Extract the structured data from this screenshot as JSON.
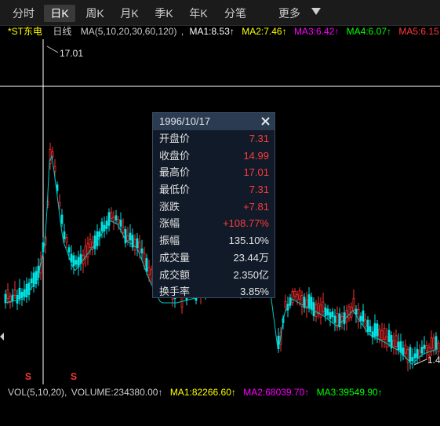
{
  "tabs": [
    {
      "label": "分时",
      "active": false
    },
    {
      "label": "日K",
      "active": true
    },
    {
      "label": "周K",
      "active": false
    },
    {
      "label": "月K",
      "active": false
    },
    {
      "label": "季K",
      "active": false
    },
    {
      "label": "年K",
      "active": false
    },
    {
      "label": "分笔",
      "active": false
    },
    {
      "label": "更多",
      "active": false
    }
  ],
  "ma_line": {
    "stock_name": "*ST东电",
    "period": "日线",
    "ma_params": "MA(5,10,20,30,60,120)",
    "ma1": "MA1:8.53↑",
    "ma2": "MA2:7.46↑",
    "ma3": "MA3:6.42↑",
    "ma4": "MA4:6.07↑",
    "ma5": "MA5:6.15",
    "colors": {
      "stock": "#ffff00",
      "label": "#cccccc",
      "ma1": "#ffffff",
      "ma2": "#ffff00",
      "ma3": "#ff00ff",
      "ma4": "#00ff00",
      "ma5": "#ff3b3b",
      "arrow": "#ff3b3b"
    }
  },
  "chart_data": {
    "type": "line",
    "title": "",
    "max_label": "17.01",
    "right_label": "1.4",
    "signal_glyph": "S",
    "cursor_date": "1996/10/17",
    "up_color": "#ff3030",
    "down_color": "#00e5e5",
    "ma_color": "#00c8c8",
    "notes": "Daily candlestick price history with moving averages; values estimated from picture"
  },
  "volume_line": {
    "vol_params": "VOL(5,10,20),",
    "volume": "VOLUME:234380.00↑",
    "ma1": "MA1:82266.60↑",
    "ma2": "MA2:68039.70↑",
    "ma3": "MA3:39549.90↑",
    "colors": {
      "label": "#cccccc",
      "ma1": "#ffff00",
      "ma2": "#ff00ff",
      "ma3": "#00ff00",
      "arrow": "#ff3b3b"
    }
  },
  "tooltip": {
    "date": "1996/10/17",
    "rows": [
      {
        "label": "开盘价",
        "value": "7.31",
        "color": "red"
      },
      {
        "label": "收盘价",
        "value": "14.99",
        "color": "red"
      },
      {
        "label": "最高价",
        "value": "17.01",
        "color": "red"
      },
      {
        "label": "最低价",
        "value": "7.31",
        "color": "red"
      },
      {
        "label": "涨跌",
        "value": "+7.81",
        "color": "red"
      },
      {
        "label": "涨幅",
        "value": "+108.77%",
        "color": "red"
      },
      {
        "label": "振幅",
        "value": "135.10%",
        "color": "white"
      },
      {
        "label": "成交量",
        "value": "23.44万",
        "color": "white"
      },
      {
        "label": "成交额",
        "value": "2.350亿",
        "color": "white"
      },
      {
        "label": "换手率",
        "value": "3.85%",
        "color": "white"
      }
    ]
  }
}
